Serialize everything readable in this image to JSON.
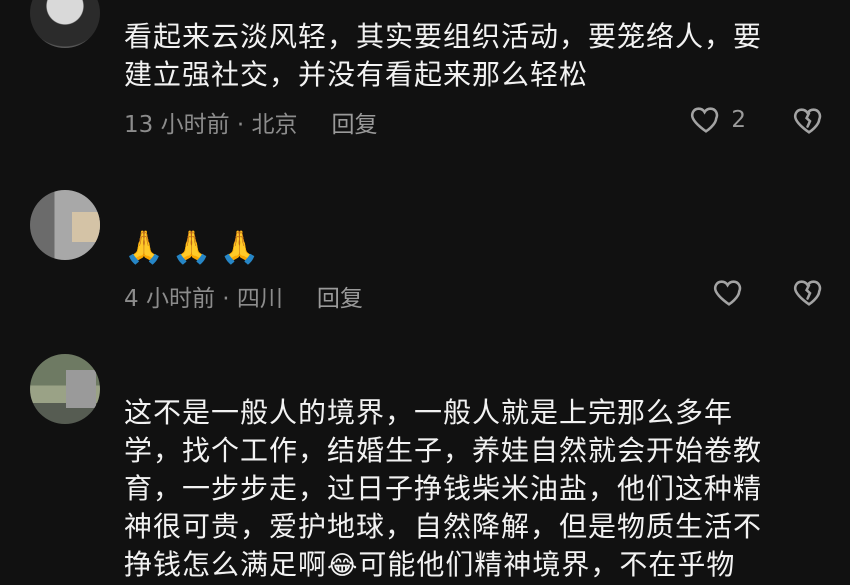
{
  "comments": [
    {
      "text_lines": [
        "看起来云淡风轻，其实要组织活动，要笼络人，要",
        "建立强社交，并没有看起来那么轻松"
      ],
      "time": "13 小时前 · 北京",
      "reply": "回复",
      "likes": "2"
    },
    {
      "text": "🙏🙏🙏",
      "time": "4 小时前 · 四川",
      "reply": "回复",
      "likes": ""
    },
    {
      "text_lines": [
        "这不是一般人的境界，一般人就是上完那么多年",
        "学，找个工作，结婚生子，养娃自然就会开始卷教",
        "育，一步步走，过日子挣钱柴米油盐，他们这种精",
        "神很可贵，爱护地球，自然降解，但是物质生活不",
        "挣钱怎么满足啊",
        "可能他们精神境界，不在乎物"
      ],
      "inline_emoji": "😂"
    }
  ],
  "icons": {
    "like": "heart-outline-icon",
    "dislike": "broken-heart-icon"
  }
}
